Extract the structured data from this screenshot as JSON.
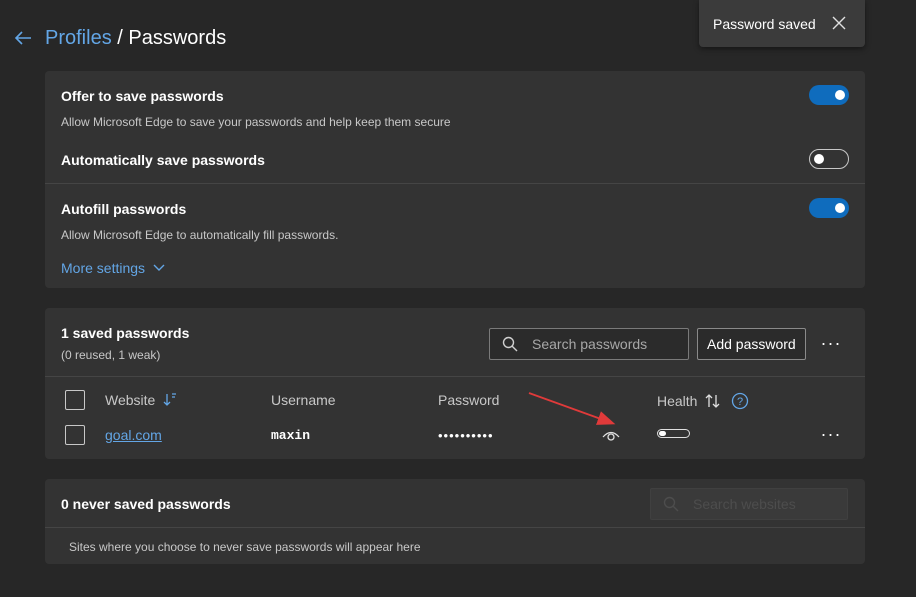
{
  "breadcrumb": {
    "parent": "Profiles",
    "separator": "/",
    "current": "Passwords"
  },
  "toast": {
    "message": "Password saved"
  },
  "settings": {
    "offer_save": {
      "title": "Offer to save passwords",
      "description": "Allow Microsoft Edge to save your passwords and help keep them secure",
      "enabled": true
    },
    "auto_save": {
      "title": "Automatically save passwords",
      "enabled": false
    },
    "autofill": {
      "title": "Autofill passwords",
      "description": "Allow Microsoft Edge to automatically fill passwords.",
      "enabled": true
    },
    "more_settings": "More settings"
  },
  "saved": {
    "title": "1 saved passwords",
    "subtitle": "(0 reused, 1 weak)",
    "search_placeholder": "Search passwords",
    "add_button": "Add password",
    "columns": {
      "website": "Website",
      "username": "Username",
      "password": "Password",
      "health": "Health"
    },
    "rows": [
      {
        "website": "goal.com",
        "username": "maxin",
        "password": "••••••••••",
        "health_level": 0.25
      }
    ]
  },
  "never_saved": {
    "title": "0 never saved passwords",
    "search_placeholder": "Search websites",
    "empty_text": "Sites where you choose to never save passwords will appear here"
  },
  "colors": {
    "background": "#272727",
    "card": "#333333",
    "accent": "#0f6cbd",
    "link": "#63a6e6",
    "annotation_arrow": "#e03a3a"
  }
}
